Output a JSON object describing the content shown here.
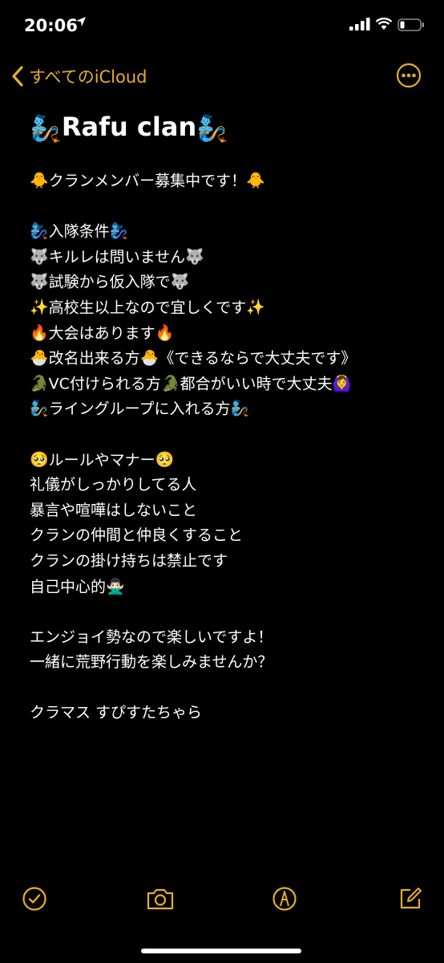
{
  "status_bar": {
    "time": "20:06"
  },
  "nav": {
    "back_label": "すべてのiCloud"
  },
  "note": {
    "title_emoji": "🧞",
    "title": "Rafu clan",
    "lines": [
      {
        "e1": "🐥",
        "text": "クランメンバー募集中です！",
        "e2": "🐥",
        "mid": "",
        "e3": "",
        "tail": ""
      },
      {
        "e1": "",
        "text": "",
        "e2": "",
        "mid": "",
        "e3": "",
        "tail": ""
      },
      {
        "e1": "🧞‍♀️",
        "text": "入隊条件",
        "e2": "🧞‍♀️",
        "mid": "",
        "e3": "",
        "tail": ""
      },
      {
        "e1": "🐺",
        "text": "キルレは問いません",
        "e2": "🐺",
        "mid": "",
        "e3": "",
        "tail": ""
      },
      {
        "e1": "🐺",
        "text": "試験から仮入隊で",
        "e2": "🐺",
        "mid": "",
        "e3": "",
        "tail": ""
      },
      {
        "e1": "✨",
        "text": "高校生以上なので宜しくです",
        "e2": "✨",
        "mid": "",
        "e3": "",
        "tail": ""
      },
      {
        "e1": "🔥",
        "text": "大会はあります",
        "e2": "🔥",
        "mid": "",
        "e3": "",
        "tail": ""
      },
      {
        "e1": "🐣",
        "text": "改名出来る方",
        "e2": "🐣",
        "mid": "《できるならで大丈夫です》",
        "e3": "",
        "tail": ""
      },
      {
        "e1": "🐊",
        "text": "VC付けられる方",
        "e2": "🐊",
        "mid": "都合がいい時で大丈夫",
        "e3": "🙆‍♀️",
        "tail": ""
      },
      {
        "e1": "🧞",
        "text": "ライングループに入れる方",
        "e2": "🧞",
        "mid": "",
        "e3": "",
        "tail": ""
      },
      {
        "e1": "",
        "text": "",
        "e2": "",
        "mid": "",
        "e3": "",
        "tail": ""
      },
      {
        "e1": "🥺",
        "text": "ルールやマナー",
        "e2": "🥺",
        "mid": "",
        "e3": "",
        "tail": ""
      },
      {
        "e1": "",
        "text": "礼儀がしっかりしてる人",
        "e2": "",
        "mid": "",
        "e3": "",
        "tail": ""
      },
      {
        "e1": "",
        "text": "暴言や喧嘩はしないこと",
        "e2": "",
        "mid": "",
        "e3": "",
        "tail": ""
      },
      {
        "e1": "",
        "text": "クランの仲間と仲良くすること",
        "e2": "",
        "mid": "",
        "e3": "",
        "tail": ""
      },
      {
        "e1": "",
        "text": "クランの掛け持ちは禁止です",
        "e2": "",
        "mid": "",
        "e3": "",
        "tail": ""
      },
      {
        "e1": "",
        "text": "自己中心的",
        "e2": "🙅🏻‍♂️",
        "mid": "",
        "e3": "",
        "tail": ""
      },
      {
        "e1": "",
        "text": "",
        "e2": "",
        "mid": "",
        "e3": "",
        "tail": ""
      },
      {
        "e1": "",
        "text": "エンジョイ勢なので楽しいですよ！",
        "e2": "",
        "mid": "",
        "e3": "",
        "tail": ""
      },
      {
        "e1": "",
        "text": "一緒に荒野行動を楽しみませんか？",
        "e2": "",
        "mid": "",
        "e3": "",
        "tail": ""
      },
      {
        "e1": "",
        "text": "",
        "e2": "",
        "mid": "",
        "e3": "",
        "tail": ""
      },
      {
        "e1": "",
        "text": "クラマス すぴすたちゃら",
        "e2": "",
        "mid": "",
        "e3": "",
        "tail": ""
      }
    ]
  },
  "colors": {
    "accent": "#e5ad2c",
    "background": "#000000",
    "text": "#ffffff"
  },
  "icons": {
    "back": "chevron-left-icon",
    "more": "ellipsis-circle-icon",
    "check": "checklist-icon",
    "camera": "camera-icon",
    "markup": "pen-circle-icon",
    "compose": "compose-icon"
  }
}
